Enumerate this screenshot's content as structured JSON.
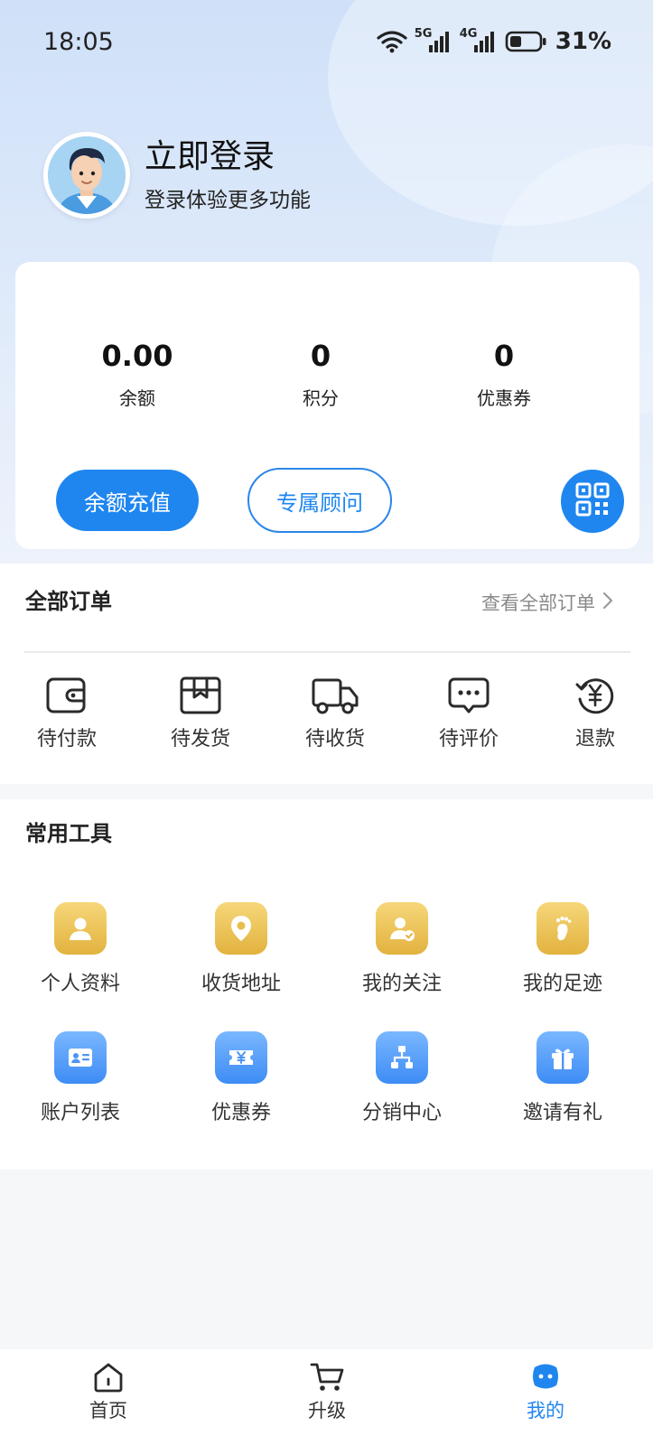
{
  "status_bar": {
    "time": "18:05",
    "network1": "5G",
    "network2": "4G",
    "battery": "31%",
    "battery_level": 0.31
  },
  "profile": {
    "title": "立即登录",
    "subtitle": "登录体验更多功能"
  },
  "assets": {
    "stats": [
      {
        "value": "0.00",
        "label": "余额"
      },
      {
        "value": "0",
        "label": "积分"
      },
      {
        "value": "0",
        "label": "优惠券"
      }
    ],
    "recharge_label": "余额充值",
    "advisor_label": "专属顾问",
    "qr_icon": "qr-code-icon"
  },
  "orders": {
    "title": "全部订单",
    "view_all": "查看全部订单",
    "items": [
      {
        "label": "待付款",
        "icon": "wallet-icon"
      },
      {
        "label": "待发货",
        "icon": "box-icon"
      },
      {
        "label": "待收货",
        "icon": "truck-icon"
      },
      {
        "label": "待评价",
        "icon": "chat-icon"
      },
      {
        "label": "退款",
        "icon": "refund-icon"
      }
    ]
  },
  "tools": {
    "title": "常用工具",
    "items": [
      {
        "label": "个人资料",
        "icon": "person-icon",
        "color": "gold"
      },
      {
        "label": "收货地址",
        "icon": "location-icon",
        "color": "gold"
      },
      {
        "label": "我的关注",
        "icon": "follow-icon",
        "color": "gold"
      },
      {
        "label": "我的足迹",
        "icon": "footprint-icon",
        "color": "gold"
      },
      {
        "label": "账户列表",
        "icon": "id-card-icon",
        "color": "blue"
      },
      {
        "label": "优惠券",
        "icon": "coupon-icon",
        "color": "blue"
      },
      {
        "label": "分销中心",
        "icon": "hierarchy-icon",
        "color": "blue"
      },
      {
        "label": "邀请有礼",
        "icon": "gift-icon",
        "color": "blue"
      }
    ]
  },
  "bottom_nav": {
    "items": [
      {
        "label": "首页",
        "icon": "home-icon"
      },
      {
        "label": "升级",
        "icon": "cart-icon"
      },
      {
        "label": "我的",
        "icon": "profile-face-icon",
        "active": true
      }
    ]
  },
  "colors": {
    "accent": "#1f86f0",
    "gold": "#e2b23e"
  }
}
